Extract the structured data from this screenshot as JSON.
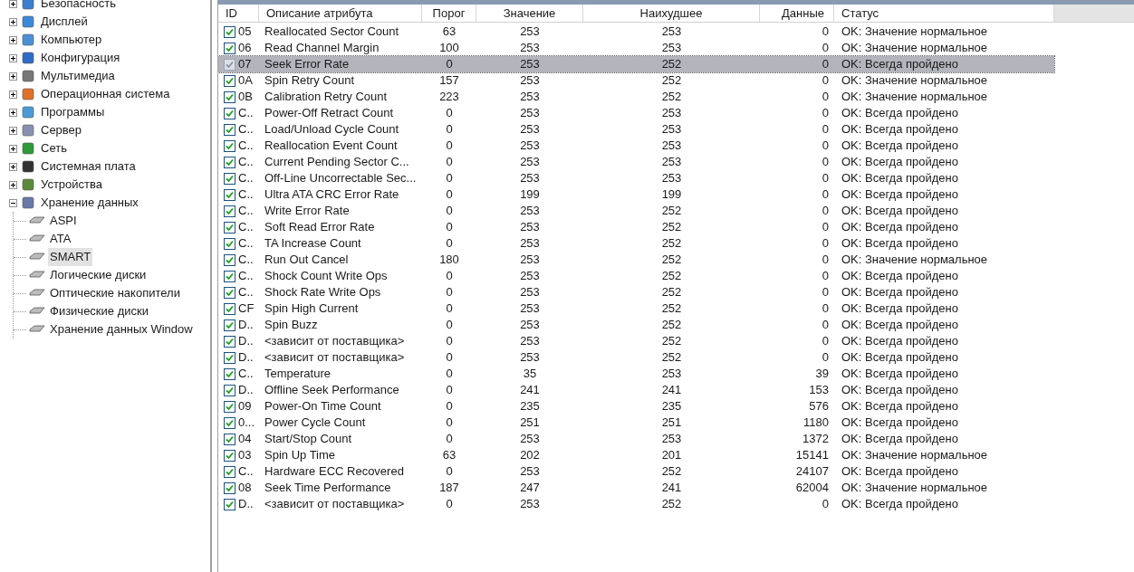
{
  "tree": [
    {
      "label": "Безопасность",
      "expanded": false
    },
    {
      "label": "Дисплей",
      "expanded": false
    },
    {
      "label": "Компьютер",
      "expanded": false
    },
    {
      "label": "Конфигурация",
      "expanded": false
    },
    {
      "label": "Мультимедиа",
      "expanded": false
    },
    {
      "label": "Операционная система",
      "expanded": false
    },
    {
      "label": "Программы",
      "expanded": false
    },
    {
      "label": "Сервер",
      "expanded": false
    },
    {
      "label": "Сеть",
      "expanded": false
    },
    {
      "label": "Системная плата",
      "expanded": false
    },
    {
      "label": "Устройства",
      "expanded": false
    },
    {
      "label": "Хранение данных",
      "expanded": true,
      "children": [
        {
          "label": "ASPI",
          "selected": false
        },
        {
          "label": "ATA",
          "selected": false
        },
        {
          "label": "SMART",
          "selected": true
        },
        {
          "label": "Логические диски",
          "selected": false
        },
        {
          "label": "Оптические накопители",
          "selected": false
        },
        {
          "label": "Физические диски",
          "selected": false
        },
        {
          "label": "Хранение данных Window",
          "selected": false
        }
      ]
    }
  ],
  "table": {
    "columns": [
      "ID",
      "Описание атрибута",
      "Порог",
      "Значение",
      "Наихудшее",
      "Данные",
      "Статус"
    ],
    "rows": [
      {
        "checked": true,
        "selected": false,
        "id": "05",
        "name": "Reallocated Sector Count",
        "threshold": "63",
        "value": "253",
        "worst": "253",
        "data": "0",
        "status": "OK: Значение нормальное"
      },
      {
        "checked": true,
        "selected": false,
        "id": "06",
        "name": "Read Channel Margin",
        "threshold": "100",
        "value": "253",
        "worst": "253",
        "data": "0",
        "status": "OK: Значение нормальное"
      },
      {
        "checked": true,
        "selected": true,
        "id": "07",
        "name": "Seek Error Rate",
        "threshold": "0",
        "value": "253",
        "worst": "252",
        "data": "0",
        "status": "OK: Всегда пройдено"
      },
      {
        "checked": true,
        "selected": false,
        "id": "0A",
        "name": "Spin Retry Count",
        "threshold": "157",
        "value": "253",
        "worst": "252",
        "data": "0",
        "status": "OK: Значение нормальное"
      },
      {
        "checked": true,
        "selected": false,
        "id": "0B",
        "name": "Calibration Retry Count",
        "threshold": "223",
        "value": "253",
        "worst": "252",
        "data": "0",
        "status": "OK: Значение нормальное"
      },
      {
        "checked": true,
        "selected": false,
        "id": "C..",
        "name": "Power-Off Retract Count",
        "threshold": "0",
        "value": "253",
        "worst": "253",
        "data": "0",
        "status": "OK: Всегда пройдено"
      },
      {
        "checked": true,
        "selected": false,
        "id": "C..",
        "name": "Load/Unload Cycle Count",
        "threshold": "0",
        "value": "253",
        "worst": "253",
        "data": "0",
        "status": "OK: Всегда пройдено"
      },
      {
        "checked": true,
        "selected": false,
        "id": "C..",
        "name": "Reallocation Event Count",
        "threshold": "0",
        "value": "253",
        "worst": "253",
        "data": "0",
        "status": "OK: Всегда пройдено"
      },
      {
        "checked": true,
        "selected": false,
        "id": "C..",
        "name": "Current Pending Sector C...",
        "threshold": "0",
        "value": "253",
        "worst": "253",
        "data": "0",
        "status": "OK: Всегда пройдено"
      },
      {
        "checked": true,
        "selected": false,
        "id": "C..",
        "name": "Off-Line Uncorrectable Sec...",
        "threshold": "0",
        "value": "253",
        "worst": "253",
        "data": "0",
        "status": "OK: Всегда пройдено"
      },
      {
        "checked": true,
        "selected": false,
        "id": "C..",
        "name": "Ultra ATA CRC Error Rate",
        "threshold": "0",
        "value": "199",
        "worst": "199",
        "data": "0",
        "status": "OK: Всегда пройдено"
      },
      {
        "checked": true,
        "selected": false,
        "id": "C..",
        "name": "Write Error Rate",
        "threshold": "0",
        "value": "253",
        "worst": "252",
        "data": "0",
        "status": "OK: Всегда пройдено"
      },
      {
        "checked": true,
        "selected": false,
        "id": "C..",
        "name": "Soft Read Error Rate",
        "threshold": "0",
        "value": "253",
        "worst": "252",
        "data": "0",
        "status": "OK: Всегда пройдено"
      },
      {
        "checked": true,
        "selected": false,
        "id": "C..",
        "name": "TA Increase Count",
        "threshold": "0",
        "value": "253",
        "worst": "252",
        "data": "0",
        "status": "OK: Всегда пройдено"
      },
      {
        "checked": true,
        "selected": false,
        "id": "C..",
        "name": "Run Out Cancel",
        "threshold": "180",
        "value": "253",
        "worst": "252",
        "data": "0",
        "status": "OK: Значение нормальное"
      },
      {
        "checked": true,
        "selected": false,
        "id": "C..",
        "name": "Shock Count Write Ops",
        "threshold": "0",
        "value": "253",
        "worst": "252",
        "data": "0",
        "status": "OK: Всегда пройдено"
      },
      {
        "checked": true,
        "selected": false,
        "id": "C..",
        "name": "Shock Rate Write Ops",
        "threshold": "0",
        "value": "253",
        "worst": "252",
        "data": "0",
        "status": "OK: Всегда пройдено"
      },
      {
        "checked": true,
        "selected": false,
        "id": "CF",
        "name": "Spin High Current",
        "threshold": "0",
        "value": "253",
        "worst": "252",
        "data": "0",
        "status": "OK: Всегда пройдено"
      },
      {
        "checked": true,
        "selected": false,
        "id": "D..",
        "name": "Spin Buzz",
        "threshold": "0",
        "value": "253",
        "worst": "252",
        "data": "0",
        "status": "OK: Всегда пройдено"
      },
      {
        "checked": true,
        "selected": false,
        "id": "D..",
        "name": "<зависит от поставщика>",
        "threshold": "0",
        "value": "253",
        "worst": "252",
        "data": "0",
        "status": "OK: Всегда пройдено"
      },
      {
        "checked": true,
        "selected": false,
        "id": "D..",
        "name": "<зависит от поставщика>",
        "threshold": "0",
        "value": "253",
        "worst": "252",
        "data": "0",
        "status": "OK: Всегда пройдено"
      },
      {
        "checked": true,
        "selected": false,
        "id": "C..",
        "name": "Temperature",
        "threshold": "0",
        "value": "35",
        "worst": "253",
        "data": "39",
        "status": "OK: Всегда пройдено"
      },
      {
        "checked": true,
        "selected": false,
        "id": "D..",
        "name": "Offline Seek Performance",
        "threshold": "0",
        "value": "241",
        "worst": "241",
        "data": "153",
        "status": "OK: Всегда пройдено"
      },
      {
        "checked": true,
        "selected": false,
        "id": "09",
        "name": "Power-On Time Count",
        "threshold": "0",
        "value": "235",
        "worst": "235",
        "data": "576",
        "status": "OK: Всегда пройдено"
      },
      {
        "checked": true,
        "selected": false,
        "id": "0...",
        "name": "Power Cycle Count",
        "threshold": "0",
        "value": "251",
        "worst": "251",
        "data": "1180",
        "status": "OK: Всегда пройдено"
      },
      {
        "checked": true,
        "selected": false,
        "id": "04",
        "name": "Start/Stop Count",
        "threshold": "0",
        "value": "253",
        "worst": "253",
        "data": "1372",
        "status": "OK: Всегда пройдено"
      },
      {
        "checked": true,
        "selected": false,
        "id": "03",
        "name": "Spin Up Time",
        "threshold": "63",
        "value": "202",
        "worst": "201",
        "data": "15141",
        "status": "OK: Значение нормальное"
      },
      {
        "checked": true,
        "selected": false,
        "id": "C..",
        "name": "Hardware ECC Recovered",
        "threshold": "0",
        "value": "253",
        "worst": "252",
        "data": "24107",
        "status": "OK: Всегда пройдено"
      },
      {
        "checked": true,
        "selected": false,
        "id": "08",
        "name": "Seek Time Performance",
        "threshold": "187",
        "value": "247",
        "worst": "241",
        "data": "62004",
        "status": "OK: Значение нормальное"
      },
      {
        "checked": true,
        "selected": false,
        "id": "D..",
        "name": "<зависит от поставщика>",
        "threshold": "0",
        "value": "253",
        "worst": "252",
        "data": "0",
        "status": "OK: Всегда пройдено"
      }
    ]
  }
}
